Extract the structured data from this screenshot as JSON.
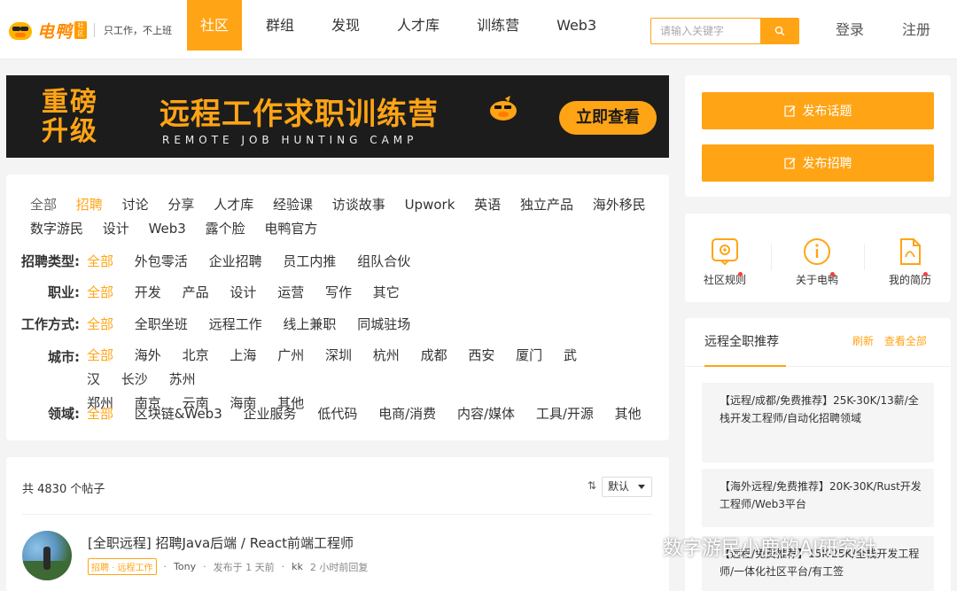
{
  "header": {
    "logo_text": "电鸭",
    "logo_badge": "社区",
    "slogan": "只工作，不上班",
    "nav": [
      "社区",
      "群组",
      "发现",
      "人才库",
      "训练营",
      "Web3"
    ],
    "nav_active": 0,
    "search_placeholder": "请输入关键字",
    "login": "登录",
    "register": "注册"
  },
  "banner": {
    "left_line1": "重磅",
    "left_line2": "升级",
    "title": "远程工作求职训练营",
    "subtitle": "REMOTE JOB HUNTING CAMP",
    "button": "立即查看"
  },
  "categories": {
    "row1": [
      "全部",
      "招聘",
      "讨论",
      "分享",
      "人才库",
      "经验课",
      "访谈故事",
      "Upwork",
      "英语",
      "独立产品",
      "海外移民"
    ],
    "row2": [
      "数字游民",
      "设计",
      "Web3",
      "露个脸",
      "电鸭官方"
    ],
    "active": "招聘"
  },
  "filters": [
    {
      "label": "招聘类型:",
      "options": [
        "全部",
        "外包零活",
        "企业招聘",
        "员工内推",
        "组队合伙"
      ]
    },
    {
      "label": "职业:",
      "options": [
        "全部",
        "开发",
        "产品",
        "设计",
        "运营",
        "写作",
        "其它"
      ]
    },
    {
      "label": "工作方式:",
      "options": [
        "全部",
        "全职坐班",
        "远程工作",
        "线上兼职",
        "同城驻场"
      ]
    },
    {
      "label": "城市:",
      "options": [
        "全部",
        "海外",
        "北京",
        "上海",
        "广州",
        "深圳",
        "杭州",
        "成都",
        "西安",
        "厦门",
        "武汉",
        "长沙",
        "苏州"
      ],
      "options_row2": [
        "郑州",
        "南京",
        "云南",
        "海南",
        "其他"
      ]
    },
    {
      "label": "领域:",
      "options": [
        "全部",
        "区块链&Web3",
        "企业服务",
        "低代码",
        "电商/消费",
        "内容/媒体",
        "工具/开源",
        "其他"
      ]
    }
  ],
  "posts": {
    "count_text": "共 4830 个帖子",
    "sort_value": "默认",
    "items": [
      {
        "title": "[全职远程] 招聘Java后端 / React前端工程师",
        "tag": "招聘 · 远程工作",
        "author": "Tony",
        "posted": "发布于 1 天前",
        "replier": "kk",
        "replied": "2 小时前回复"
      }
    ]
  },
  "sidebar": {
    "publish_topic": "发布话题",
    "publish_job": "发布招聘",
    "quick": [
      {
        "label": "社区规则",
        "icon": "gear-badge-icon"
      },
      {
        "label": "关于电鸭",
        "icon": "info-icon"
      },
      {
        "label": "我的简历",
        "icon": "pdf-icon"
      }
    ],
    "recommend_title": "远程全职推荐",
    "refresh": "刷新",
    "view_all": "查看全部",
    "cards": [
      "【远程/成都/免费推荐】25K-30K/13薪/全栈开发工程师/自动化招聘领域",
      "【海外远程/免费推荐】20K-30K/Rust开发工程师/Web3平台",
      "【远程/免费推荐】15K-25K/全栈开发工程师/一体化社区平台/有工签"
    ]
  },
  "watermark": "数字游民小鹿的AI研究社",
  "colors": {
    "accent": "#ffa415",
    "banner_bg": "#1c1c1c",
    "page_bg": "#f4f4f4",
    "dot": "#ff3b3b"
  }
}
